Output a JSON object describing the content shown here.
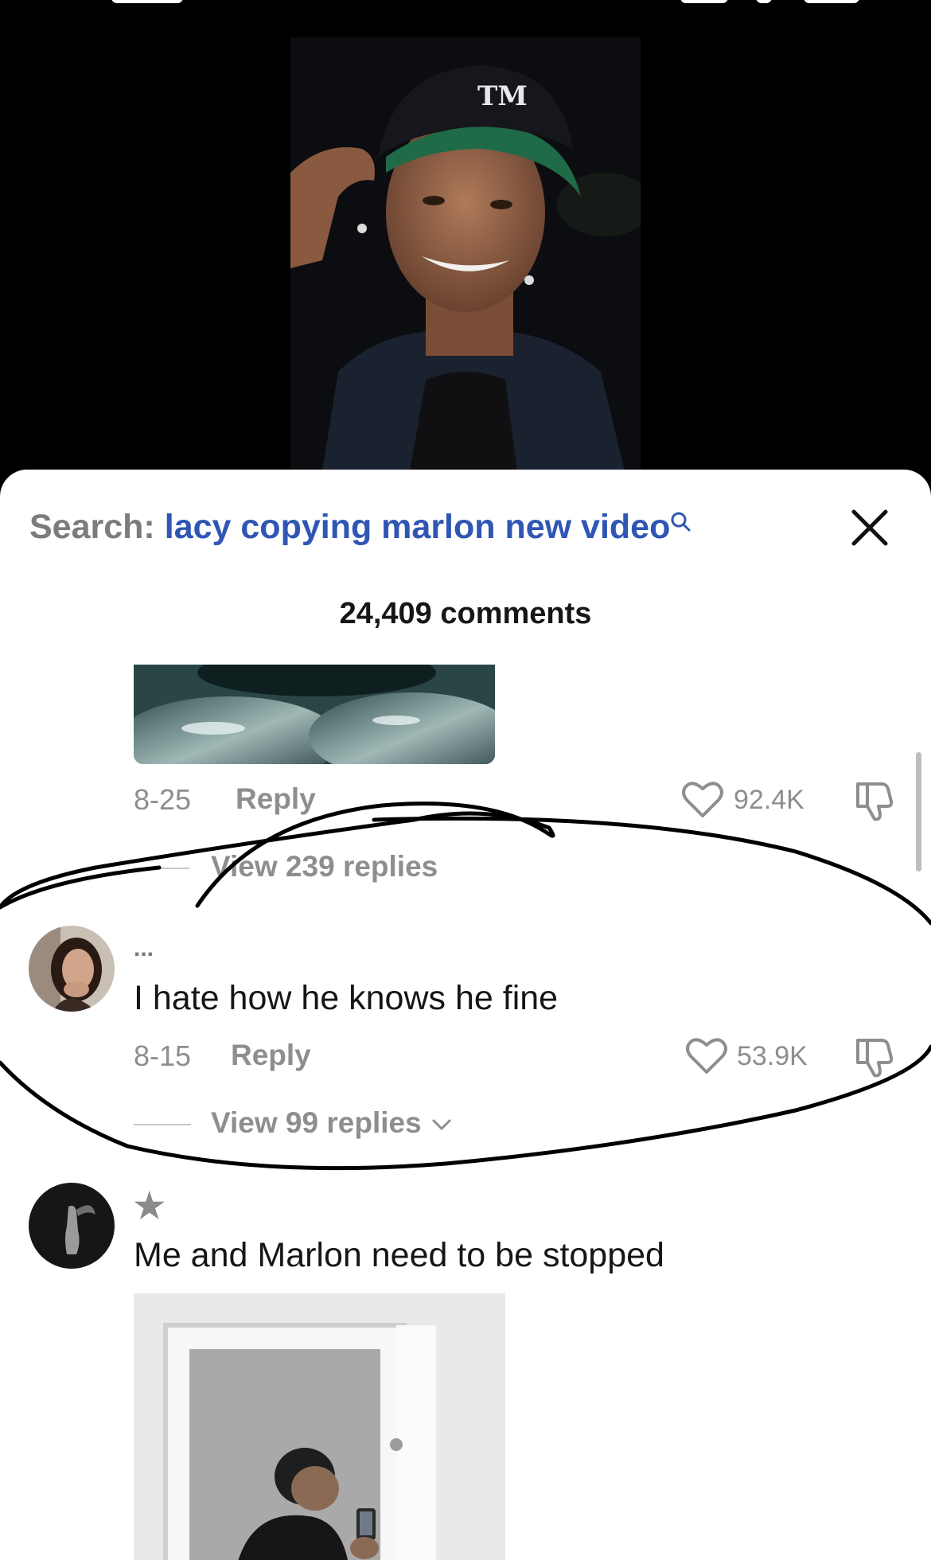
{
  "search": {
    "label": "Search:",
    "query": "lacy copying marlon new video"
  },
  "comments_header": {
    "count_label": "24,409 comments"
  },
  "comments": [
    {
      "date": "8-25",
      "reply_label": "Reply",
      "likes": "92.4K",
      "view_replies": "View 239 replies"
    },
    {
      "username": "...",
      "text": "I hate how he knows he fine",
      "date": "8-15",
      "reply_label": "Reply",
      "likes": "53.9K",
      "view_replies": "View 99 replies"
    },
    {
      "username": "★",
      "text": "Me and Marlon need to be stopped"
    }
  ],
  "colors": {
    "accent_blue": "#2f56b4",
    "muted_gray": "#8e8e8e",
    "text_dark": "#161616",
    "background_video": "#000000",
    "sheet_background": "#ffffff"
  },
  "icons": [
    "close-icon",
    "search-mini-icon",
    "heart-icon",
    "dislike-icon",
    "chevron-down-icon"
  ]
}
